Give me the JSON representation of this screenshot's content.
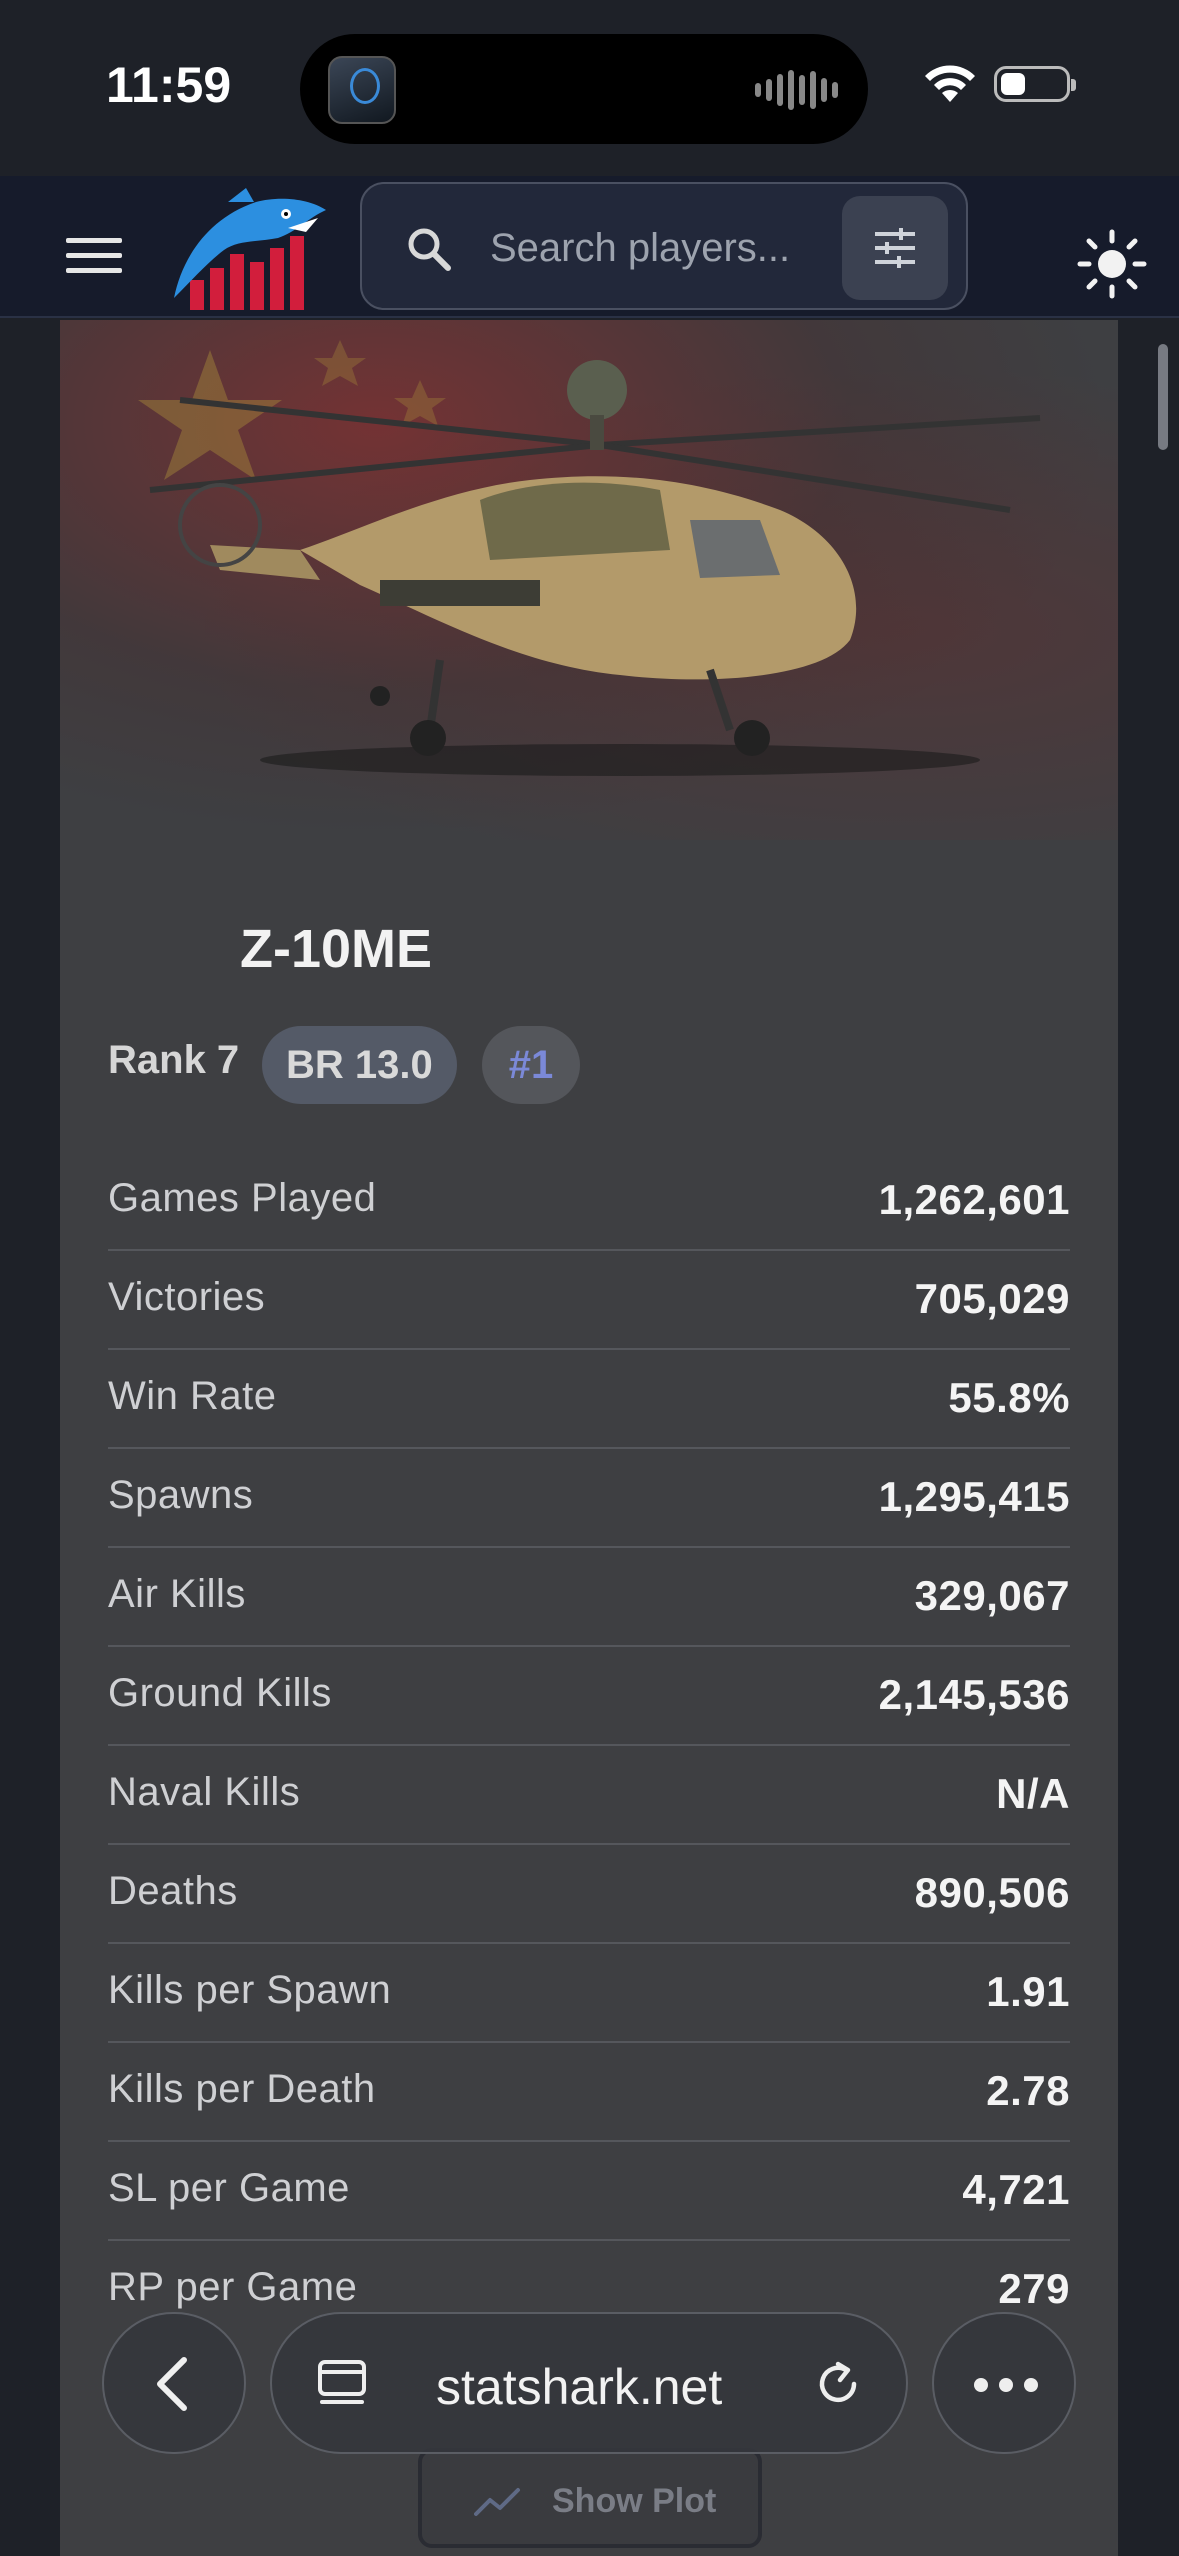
{
  "status_bar": {
    "time": "11:59",
    "wifi_icon": "wifi-icon",
    "battery_icon": "battery-icon"
  },
  "navbar": {
    "menu_icon": "hamburger-menu-icon",
    "logo": "statshark-logo",
    "search_placeholder": "Search players...",
    "filter_icon": "sliders-icon",
    "theme_icon": "sun-icon"
  },
  "vehicle": {
    "name": "Z-10ME",
    "rank": "Rank 7",
    "br": "BR 13.0",
    "position": "#1"
  },
  "stats": [
    {
      "label": "Games Played",
      "value": "1,262,601"
    },
    {
      "label": "Victories",
      "value": "705,029"
    },
    {
      "label": "Win Rate",
      "value": "55.8%"
    },
    {
      "label": "Spawns",
      "value": "1,295,415"
    },
    {
      "label": "Air Kills",
      "value": "329,067"
    },
    {
      "label": "Ground Kills",
      "value": "2,145,536"
    },
    {
      "label": "Naval Kills",
      "value": "N/A"
    },
    {
      "label": "Deaths",
      "value": "890,506"
    },
    {
      "label": "Kills per Spawn",
      "value": "1.91"
    },
    {
      "label": "Kills per Death",
      "value": "2.78"
    },
    {
      "label": "SL per Game",
      "value": "4,721"
    },
    {
      "label": "RP per Game",
      "value": "279"
    }
  ],
  "show_plot_label": "Show Plot",
  "browser": {
    "url": "statshark.net",
    "back_icon": "chevron-left-icon",
    "tabs_icon": "tabs-icon",
    "reload_icon": "reload-icon",
    "more_icon": "more-dots-icon"
  },
  "colors": {
    "page_bg": "#1e2128",
    "card_bg": "#3e3f42",
    "navbar_bg": "#161b2b",
    "accent": "#7b89d8",
    "logo_red": "#d21e3c"
  }
}
